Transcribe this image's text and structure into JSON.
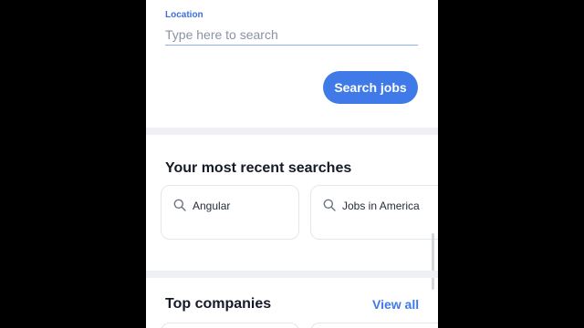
{
  "location": {
    "label": "Location",
    "placeholder": "Type here to search",
    "value": ""
  },
  "search_button": {
    "label": "Search jobs"
  },
  "recent_searches": {
    "title": "Your most recent searches",
    "items": [
      {
        "label": "Angular",
        "icon": "search-icon"
      },
      {
        "label": "Jobs in America",
        "icon": "search-icon"
      }
    ]
  },
  "top_companies": {
    "title": "Top companies",
    "view_all_label": "View all"
  },
  "colors": {
    "accent": "#3f7ae8",
    "heading": "#151a28",
    "divider": "#eef0f4"
  }
}
